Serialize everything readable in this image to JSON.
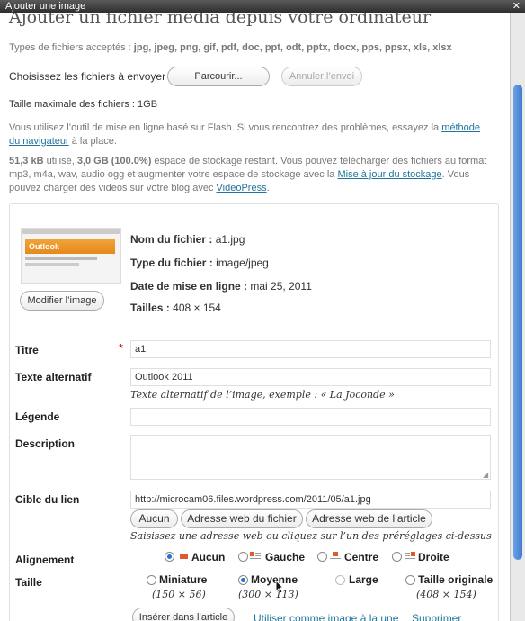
{
  "window": {
    "title": "Ajouter une image"
  },
  "heading": "Ajouter un fichier média depuis votre ordinateur",
  "accepted": {
    "label": "Types de fichiers acceptés : ",
    "types": "jpg, jpeg, png, gif, pdf, doc, ppt, odt, pptx, docx, pps, ppsx, xls, xlsx"
  },
  "choose": {
    "label": "Choisissez les fichiers à envoyer",
    "browse": "Parcourir...",
    "cancel": "Annuler l’envoi"
  },
  "max_size": "Taille maximale des fichiers : 1GB",
  "flash": {
    "text": "Vous utilisez l’outil de mise en ligne basé sur Flash. Si vous rencontrez des problèmes, essayez la ",
    "link": "méthode du navigateur",
    "after": " à la place."
  },
  "storage": {
    "used": "51,3 kB",
    "t1": " utilisé, ",
    "free": "3,0 GB (100.0%)",
    "t2": " espace de stockage restant. Vous pouvez télécharger des fichiers au format mp3, m4a, wav, audio ogg et augmenter votre espace de stockage avec la ",
    "upgrade_link": "Mise à jour du stockage",
    "t3": ". Vous pouvez charger des videos sur votre blog avec ",
    "vp_link": "VideoPress",
    "t4": "."
  },
  "file": {
    "thumb_caption": "Outlook",
    "edit_button": "Modifier l’image",
    "name_label": "Nom du fichier :",
    "name": "a1.jpg",
    "type_label": "Type du fichier :",
    "type": "image/jpeg",
    "date_label": "Date de mise en ligne :",
    "date": "mai 25, 2011",
    "size_label": "Tailles :",
    "size": "408 × 154"
  },
  "form": {
    "title_label": "Titre",
    "required_mark": "*",
    "title_value": "a1",
    "alt_label": "Texte alternatif",
    "alt_value": "Outlook 2011",
    "alt_hint": "Texte alternatif de l’image, exemple : « La Joconde »",
    "caption_label": "Légende",
    "caption_value": "",
    "desc_label": "Description",
    "desc_value": "",
    "link_label": "Cible du lien",
    "link_value": "http://microcam06.files.wordpress.com/2011/05/a1.jpg",
    "link_btn_none": "Aucun",
    "link_btn_file": "Adresse web du fichier",
    "link_btn_post": "Adresse web de l’article",
    "link_hint": "Saisissez une adresse web ou cliquez sur l’un des préréglages ci-dessus",
    "align_label": "Alignement",
    "align_options": [
      "Aucun",
      "Gauche",
      "Centre",
      "Droite"
    ],
    "align_selected": "Aucun",
    "size_label": "Taille",
    "size_options": [
      {
        "name": "Miniature",
        "dims": "(150 × 56)"
      },
      {
        "name": "Moyenne",
        "dims": "(300 × 113)"
      },
      {
        "name": "Large",
        "dims": ""
      },
      {
        "name": "Taille originale",
        "dims": "(408 × 154)"
      }
    ],
    "size_selected": "Moyenne"
  },
  "actions": {
    "insert": "Insérer dans l’article",
    "featured": "Utiliser comme image à la une",
    "delete": "Supprimer"
  },
  "colors": {
    "link": "#21759b",
    "accent": "#2a6fd6",
    "required": "#c00"
  }
}
